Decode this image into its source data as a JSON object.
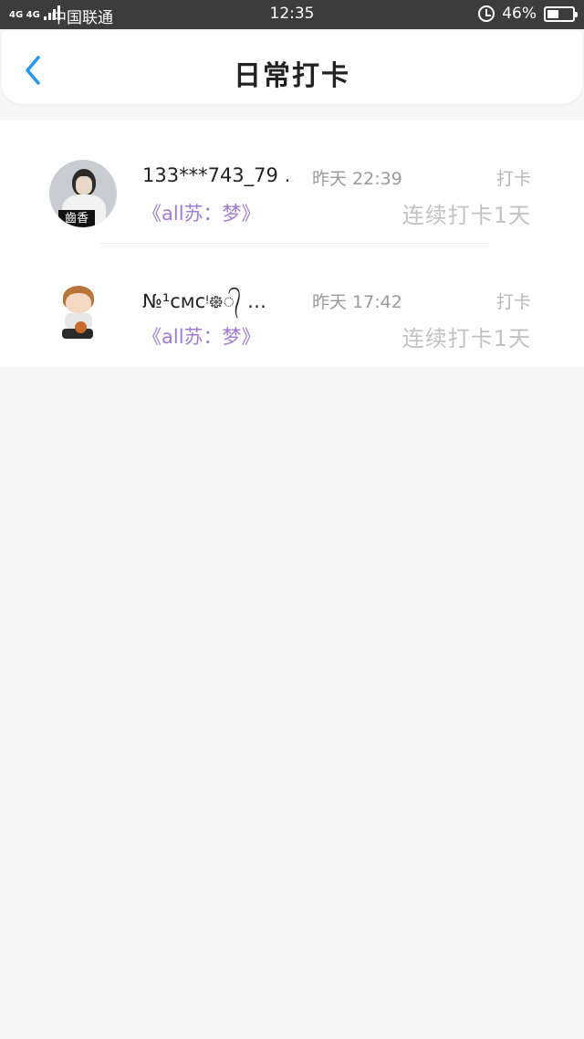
{
  "status_bar": {
    "network": "4G 4G",
    "carrier": "中国联通",
    "time": "12:35",
    "battery": "46%",
    "battery_level": 0.46
  },
  "header": {
    "title": "日常打卡",
    "back_icon": "chevron-left-icon",
    "accent_color": "#2196f3"
  },
  "checkins": [
    {
      "name": "133***743_79 …",
      "time": "昨天 22:39",
      "label": "打卡",
      "group": "《all苏：梦》",
      "streak": "连续打卡1天",
      "avatar_text": "齒香"
    },
    {
      "name": "№¹ᴄᴍᴄᵎ᪥᭄ …",
      "time": "昨天 17:42",
      "label": "打卡",
      "group": "《all苏：梦》",
      "streak": "连续打卡1天"
    }
  ],
  "colors": {
    "group_link": "#a27bd1",
    "muted": "#b6b6b6",
    "background": "#f7f7f7"
  }
}
